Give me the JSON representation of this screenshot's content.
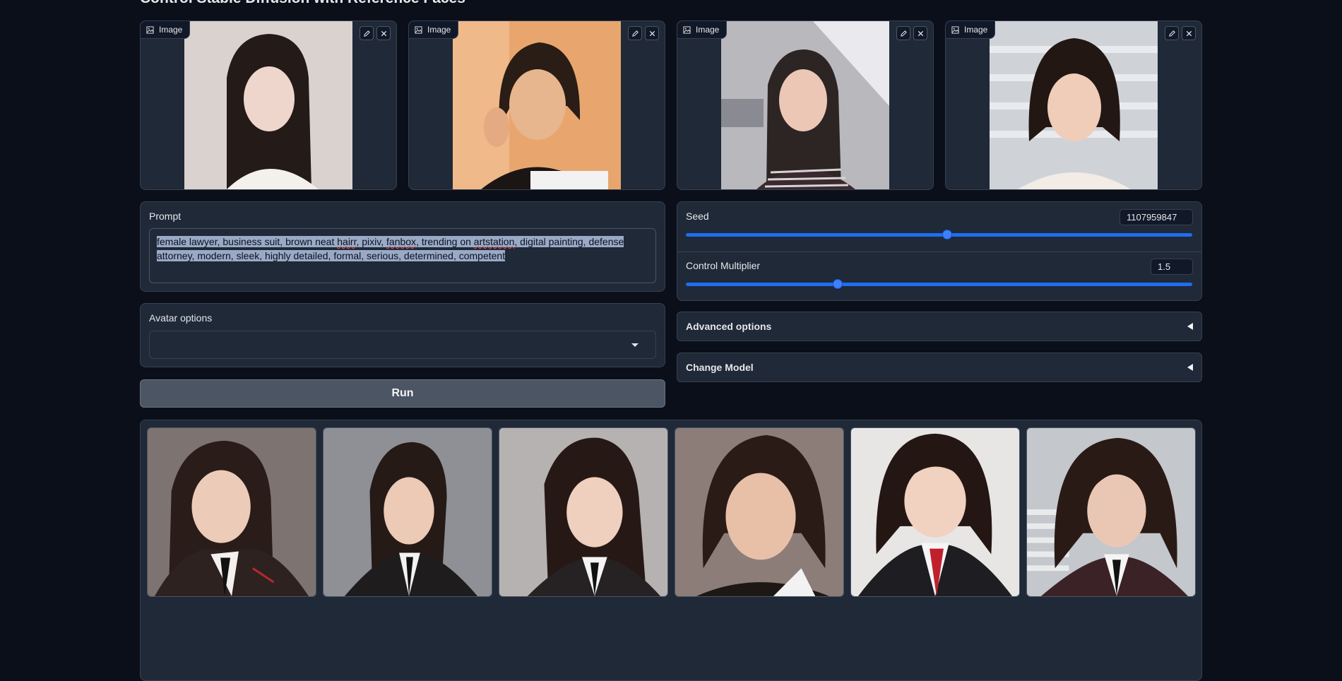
{
  "page": {
    "title": "Control Stable Diffusion with Reference Faces"
  },
  "image_inputs": [
    {
      "label": "Image"
    },
    {
      "label": "Image"
    },
    {
      "label": "Image"
    },
    {
      "label": "Image"
    }
  ],
  "prompt": {
    "label": "Prompt",
    "segments": [
      "female lawyer, business suit, brown neat ",
      "hairr",
      ", pixiv, ",
      "fanbox",
      ", trending on ",
      "artstation",
      ", digital painting, defense attorney, modern, sleek, highly detailed, formal, serious, determined, competent"
    ],
    "misspelled": [
      "hairr",
      "fanbox",
      "artstation"
    ],
    "selection_color": "#9aa9c6"
  },
  "avatar_options": {
    "label": "Avatar options",
    "selected": ""
  },
  "run_button": {
    "label": "Run"
  },
  "seed": {
    "label": "Seed",
    "value": "1107959847",
    "fraction": 0.516
  },
  "control_multiplier": {
    "label": "Control Multiplier",
    "value": "1.5",
    "fraction": 0.3
  },
  "accordions": {
    "advanced_label": "Advanced options",
    "model_label": "Change Model"
  },
  "gallery": {
    "count": 6
  },
  "colors": {
    "background": "#0b0f19",
    "panel": "#1f2937",
    "accent": "#1d6ef2",
    "button": "#4b5563"
  },
  "icons": [
    "image-icon",
    "pencil-icon",
    "close-icon",
    "chevron-down-icon",
    "triangle-left-icon"
  ]
}
